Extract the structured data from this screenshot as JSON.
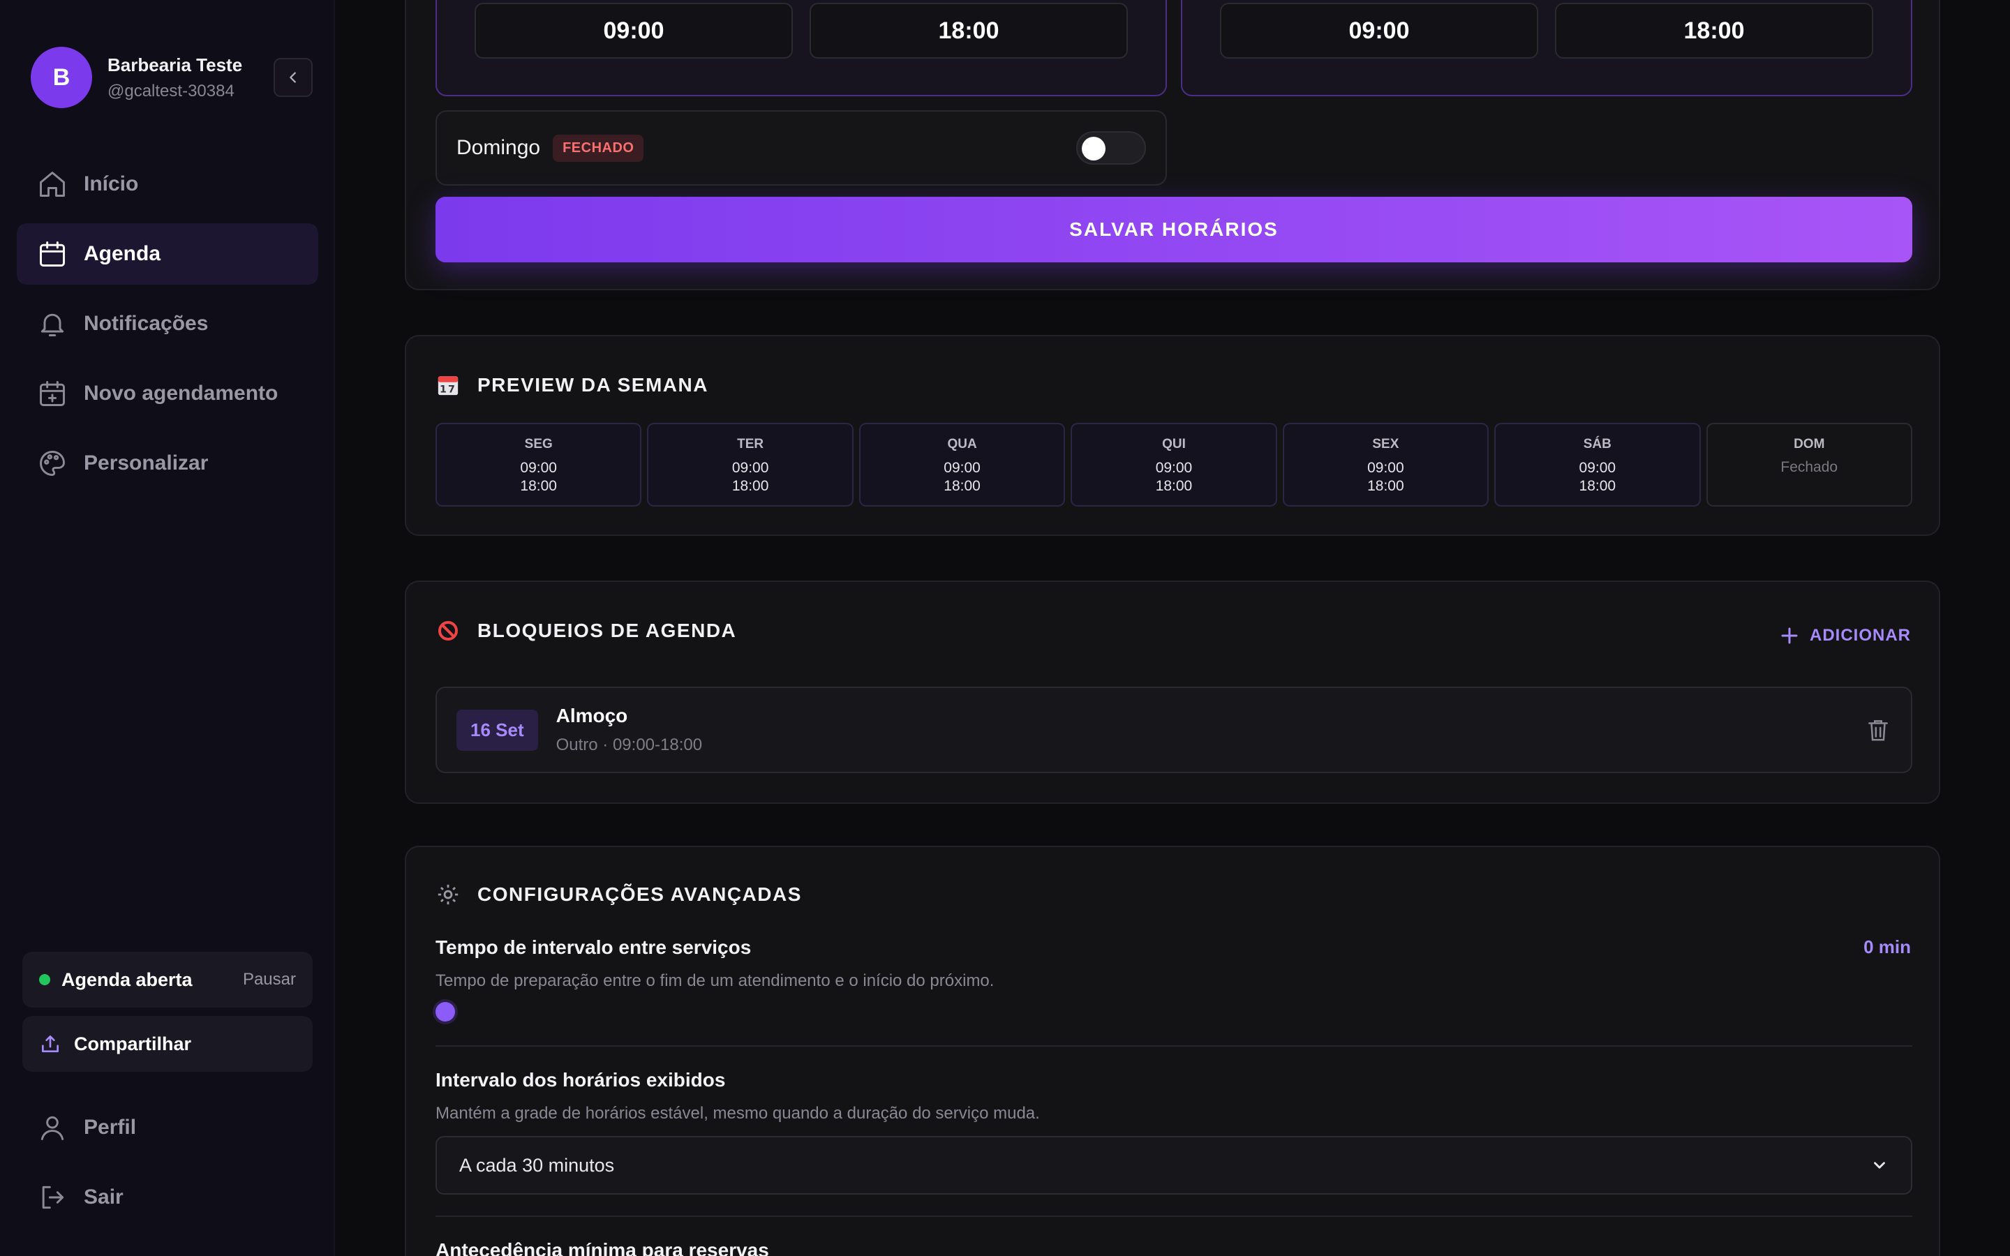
{
  "profile": {
    "initial": "B",
    "name": "Barbearia Teste",
    "handle": "@gcaltest-30384"
  },
  "nav": [
    {
      "label": "Início",
      "icon": "home-icon",
      "active": false
    },
    {
      "label": "Agenda",
      "icon": "calendar-icon",
      "active": true
    },
    {
      "label": "Notificações",
      "icon": "bell-icon",
      "active": false
    },
    {
      "label": "Novo agendamento",
      "icon": "calendar-plus-icon",
      "active": false
    },
    {
      "label": "Personalizar",
      "icon": "palette-icon",
      "active": false
    }
  ],
  "status": {
    "label": "Agenda aberta",
    "action": "Pausar",
    "color": "#22c55e"
  },
  "share": {
    "label": "Compartilhar"
  },
  "bottom_nav": [
    {
      "label": "Perfil",
      "icon": "user-icon"
    },
    {
      "label": "Sair",
      "icon": "logout-icon"
    }
  ],
  "hours": {
    "left_day": {
      "open": "09:00",
      "close": "18:00"
    },
    "right_day": {
      "open": "09:00",
      "close": "18:00"
    },
    "sunday": {
      "label": "Domingo",
      "badge": "FECHADO",
      "enabled": false
    },
    "save_label": "SALVAR HORÁRIOS"
  },
  "preview": {
    "title": "PREVIEW DA SEMANA",
    "days": [
      {
        "name": "SEG",
        "open": "09:00",
        "close": "18:00"
      },
      {
        "name": "TER",
        "open": "09:00",
        "close": "18:00"
      },
      {
        "name": "QUA",
        "open": "09:00",
        "close": "18:00"
      },
      {
        "name": "QUI",
        "open": "09:00",
        "close": "18:00"
      },
      {
        "name": "SEX",
        "open": "09:00",
        "close": "18:00"
      },
      {
        "name": "SÁB",
        "open": "09:00",
        "close": "18:00"
      },
      {
        "name": "DOM",
        "closed_label": "Fechado"
      }
    ]
  },
  "blocks": {
    "title": "BLOQUEIOS DE AGENDA",
    "add_label": "ADICIONAR",
    "items": [
      {
        "date": "16 Set",
        "title": "Almoço",
        "subtitle": "Outro · 09:00-18:00"
      }
    ]
  },
  "advanced": {
    "title": "CONFIGURAÇÕES AVANÇADAS",
    "interval_label": "Tempo de intervalo entre serviços",
    "interval_value": "0 min",
    "interval_desc": "Tempo de preparação entre o fim de um atendimento e o início do próximo.",
    "grid_label": "Intervalo dos horários exibidos",
    "grid_desc": "Mantém a grade de horários estável, mesmo quando a duração do serviço muda.",
    "grid_selected": "A cada 30 minutos",
    "next_label": "Antecedência mínima para reservas"
  },
  "colors": {
    "accent": "#7c3aed",
    "accent_light": "#a78bfa",
    "danger": "#f87171"
  }
}
